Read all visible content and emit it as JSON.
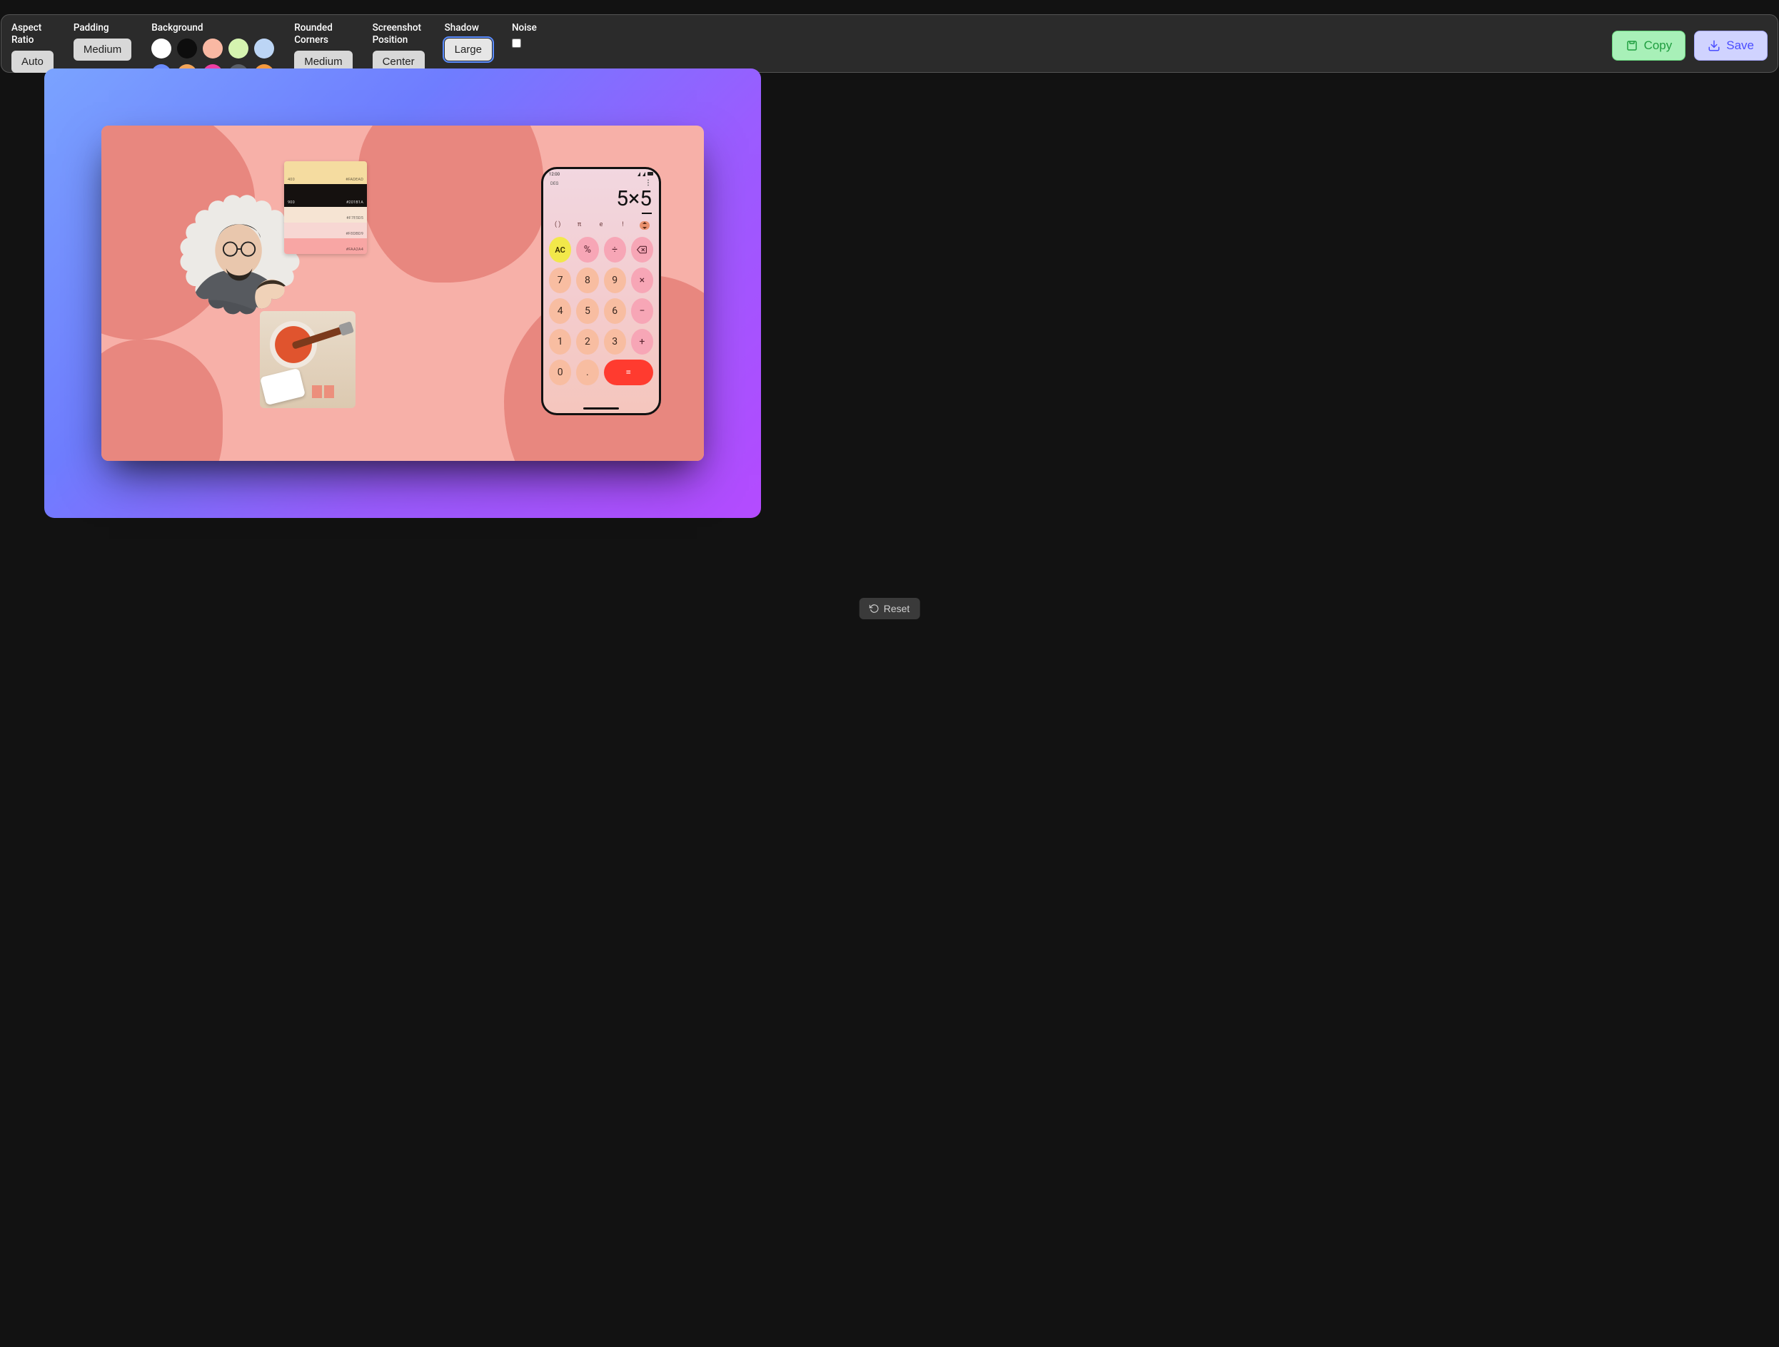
{
  "toolbar": {
    "aspect_ratio": {
      "label": "Aspect\nRatio",
      "value": "Auto"
    },
    "padding": {
      "label": "Padding",
      "value": "Medium"
    },
    "background": {
      "label": "Background",
      "swatches": [
        "#ffffff",
        "#0d0d0d",
        "#f9b8a3",
        "#d5f3b0",
        "#bcd5f5",
        "#6a8bff",
        "#f2a55a",
        "#ef3ea3",
        "#5a5f66",
        "#f59a3e"
      ]
    },
    "rounded": {
      "label": "Rounded\nCorners",
      "value": "Medium"
    },
    "position": {
      "label": "Screenshot\nPosition",
      "value": "Center"
    },
    "shadow": {
      "label": "Shadow",
      "value": "Large"
    },
    "noise": {
      "label": "Noise",
      "checked": false
    },
    "copy_label": "Copy",
    "save_label": "Save"
  },
  "reset_label": "Reset",
  "screenshot": {
    "palette": [
      {
        "shade": "400",
        "hex": "#FADEAD",
        "bg": "#f5dca0"
      },
      {
        "shade": "900",
        "hex": "#201B1A",
        "bg": "#15110f",
        "dark": true
      },
      {
        "shade": "",
        "hex": "#F7E5D5",
        "bg": "#f6e4d3"
      },
      {
        "shade": "",
        "hex": "#F8DBD9",
        "bg": "#f7d7d3"
      },
      {
        "shade": "",
        "hex": "#FAA2A4",
        "bg": "#f8a6a4"
      }
    ],
    "phone": {
      "time": "12:00",
      "mode": "DEG",
      "expression": "5×5",
      "func_row": [
        "( )",
        "π",
        "e",
        "!"
      ],
      "keys": [
        {
          "t": "AC",
          "c": "ac"
        },
        {
          "t": "%",
          "c": "op"
        },
        {
          "t": "÷",
          "c": "op"
        },
        {
          "t": "⌫",
          "c": "op del"
        },
        {
          "t": "7",
          "c": "num"
        },
        {
          "t": "8",
          "c": "num"
        },
        {
          "t": "9",
          "c": "num"
        },
        {
          "t": "×",
          "c": "op"
        },
        {
          "t": "4",
          "c": "num"
        },
        {
          "t": "5",
          "c": "num"
        },
        {
          "t": "6",
          "c": "num"
        },
        {
          "t": "−",
          "c": "op"
        },
        {
          "t": "1",
          "c": "num"
        },
        {
          "t": "2",
          "c": "num"
        },
        {
          "t": "3",
          "c": "num"
        },
        {
          "t": "+",
          "c": "op"
        },
        {
          "t": "0",
          "c": "num"
        },
        {
          "t": ".",
          "c": "num"
        },
        {
          "t": "=",
          "c": "eq"
        }
      ]
    }
  }
}
